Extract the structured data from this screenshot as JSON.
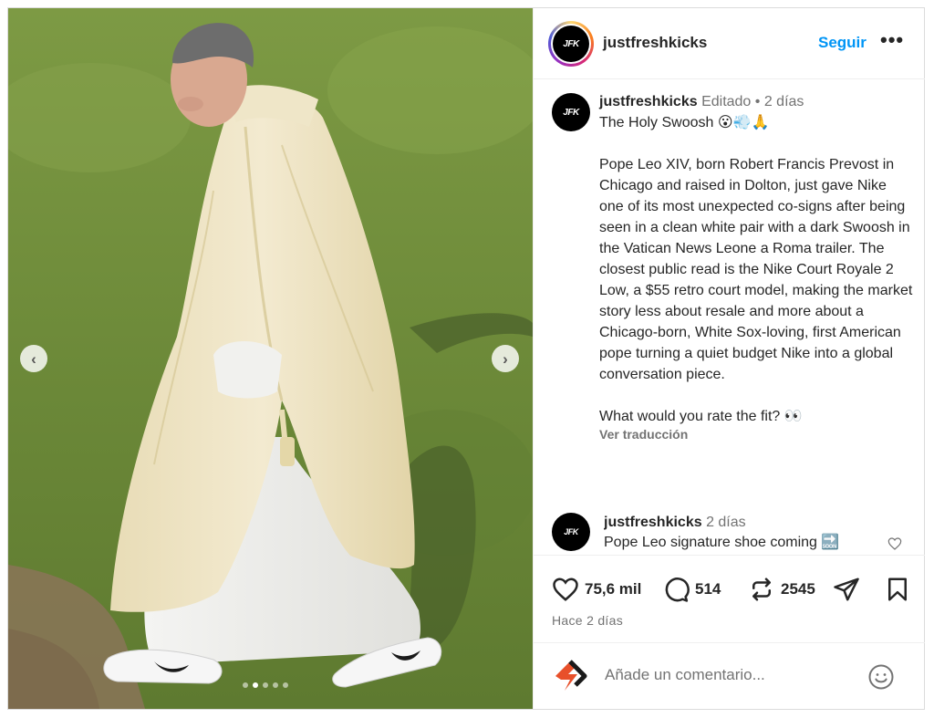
{
  "post": {
    "username": "justfreshkicks",
    "avatar_text": "JFK",
    "follow_label": "Seguir",
    "more_label": "•••",
    "carousel": {
      "total_slides": 5,
      "active_slide": 2
    }
  },
  "caption": {
    "username": "justfreshkicks",
    "edited": "Editado",
    "separator": " • ",
    "time": "2 días",
    "title": "The Holy Swoosh 😮💨🙏",
    "body": "Pope Leo XIV, born Robert Francis Prevost in Chicago and raised in Dolton, just gave Nike one of its most unexpected co-signs after being seen in a clean white pair with a dark Swoosh in the Vatican News Leone a Roma trailer. The closest public read is the Nike Court Royale 2 Low, a $55 retro court model, making the market story less about resale and more about a Chicago-born, White Sox-loving, first American pope turning a quiet budget Nike into a global conversation piece.",
    "question": "What would you rate the fit? 👀",
    "translate_label": "Ver traducción"
  },
  "comment": {
    "username": "justfreshkicks",
    "time": "2 días",
    "text": "Pope Leo signature shoe coming 🔜"
  },
  "actions": {
    "likes": "75,6 mil",
    "comments": "514",
    "reposts": "2545",
    "time_ago": "Hace 2 días"
  },
  "add_comment": {
    "placeholder": "Añade un comentario..."
  },
  "colors": {
    "accent": "#0095f6",
    "text": "#262626",
    "muted": "#737373",
    "avatar_bg": "#000000",
    "grass": "#6f8a3a",
    "vestment": "#efe6c8"
  }
}
